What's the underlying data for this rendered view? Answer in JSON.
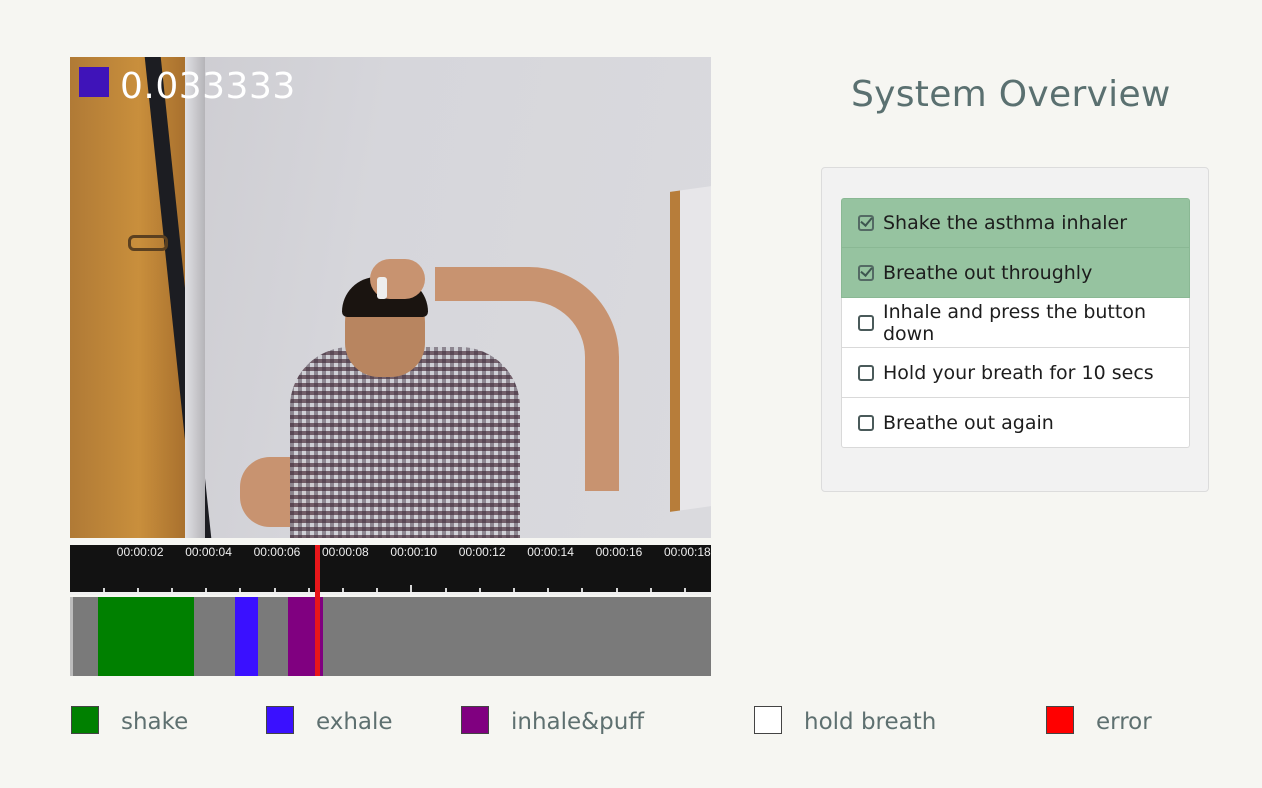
{
  "video": {
    "overlay_value": "0.033333",
    "overlay_color": "#3f13b9"
  },
  "timeline": {
    "tick_labels": [
      "00:00:02",
      "00:00:04",
      "00:00:06",
      "00:00:08",
      "00:00:10",
      "00:00:12",
      "00:00:14",
      "00:00:16",
      "00:00:18"
    ],
    "colors": {
      "ruler": "#121212",
      "track": "#7a7a7a",
      "playhead": "#e8161a"
    },
    "segments": [
      {
        "label": "shake",
        "start_sec": 0.8,
        "end_sec": 3.6,
        "color": "#008000"
      },
      {
        "label": "exhale",
        "start_sec": 4.8,
        "end_sec": 5.5,
        "color": "#3a10ff"
      },
      {
        "label": "inhale&puff",
        "start_sec": 6.35,
        "end_sec": 7.4,
        "color": "#800080"
      }
    ],
    "playhead_sec": 7.2
  },
  "legend": [
    {
      "label": "shake",
      "color": "#008000"
    },
    {
      "label": "exhale",
      "color": "#3a10ff"
    },
    {
      "label": "inhale&puff",
      "color": "#800080"
    },
    {
      "label": "hold breath",
      "color": "#ffffff"
    },
    {
      "label": "error",
      "color": "#ff0000"
    }
  ],
  "overview": {
    "title": "System Overview",
    "steps": [
      {
        "label": "Shake the asthma inhaler",
        "done": true
      },
      {
        "label": "Breathe out throughly",
        "done": true
      },
      {
        "label": "Inhale and press the button down",
        "done": false
      },
      {
        "label": "Hold your breath for 10 secs",
        "done": false
      },
      {
        "label": "Breathe out again",
        "done": false
      }
    ],
    "done_color": "#96c3a0"
  }
}
